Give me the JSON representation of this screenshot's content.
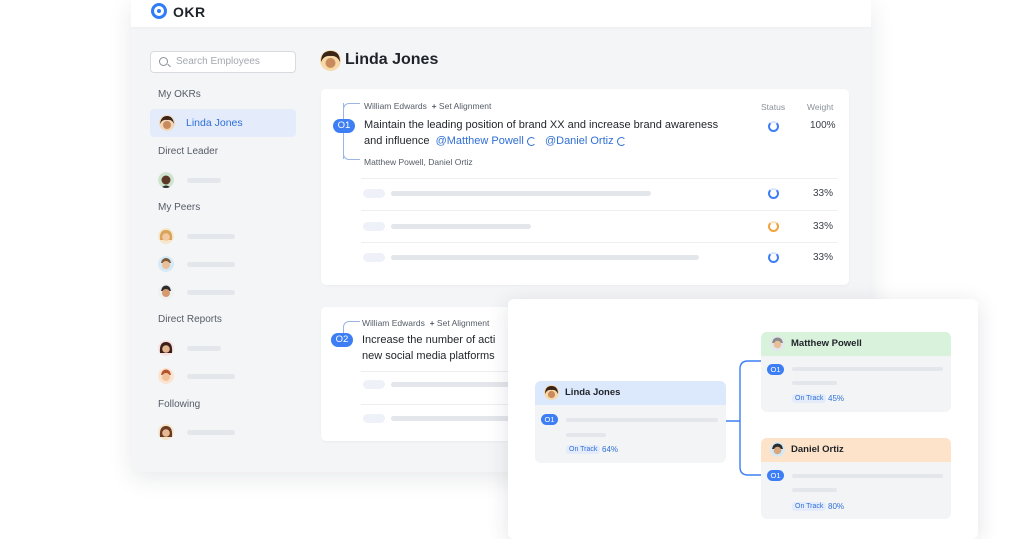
{
  "app": {
    "title": "OKR"
  },
  "sidebar": {
    "search_placeholder": "Search Employees",
    "sections": {
      "my_okrs": "My OKRs",
      "direct_leader": "Direct Leader",
      "my_peers": "My Peers",
      "direct_reports": "Direct Reports",
      "following": "Following"
    },
    "selected_user": "Linda Jones"
  },
  "main": {
    "user_name": "Linda Jones",
    "columns": {
      "status": "Status",
      "weight": "Weight"
    },
    "objectives": [
      {
        "badge": "O1",
        "aligned_with": "William Edwards",
        "set_alignment": "Set Alignment",
        "text_line1": "Maintain the leading position of brand XX and increase brand awareness",
        "text_line2_prefix": "and influence",
        "mentions": [
          "@Matthew Powell",
          "@Daniel Ortiz"
        ],
        "supporters": "Matthew Powell, Daniel Ortiz",
        "weight": "100%",
        "key_results": [
          {
            "weight": "33%",
            "status": "in-progress"
          },
          {
            "weight": "33%",
            "status": "at-risk"
          },
          {
            "weight": "33%",
            "status": "in-progress"
          }
        ]
      },
      {
        "badge": "O2",
        "aligned_with": "William Edwards",
        "set_alignment": "Set Alignment",
        "text_line1": "Increase the number of acti",
        "text_line2": "new social media platforms"
      }
    ]
  },
  "tree": {
    "root": {
      "name": "Linda Jones",
      "badge": "O1",
      "status": "On Track",
      "progress": "64%"
    },
    "children": [
      {
        "name": "Matthew Powell",
        "badge": "O1",
        "status": "On Track",
        "progress": "45%",
        "header_color": "#d9f2dc"
      },
      {
        "name": "Daniel Ortiz",
        "badge": "O1",
        "status": "On Track",
        "progress": "80%",
        "header_color": "#fde3c9"
      }
    ],
    "root_header_color": "#dce8fb"
  }
}
